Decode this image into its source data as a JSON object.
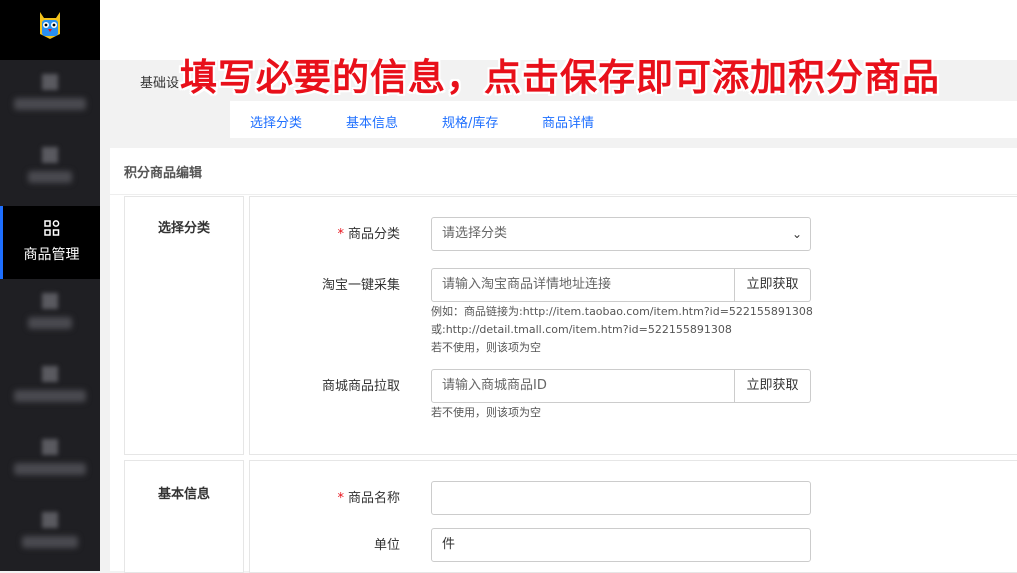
{
  "banner": "填写必要的信息，点击保存即可添加积分商品",
  "breadcrumb": "基础设",
  "sidebar": {
    "active_label": "商品管理",
    "active_icon": "grid-icon"
  },
  "tabs": [
    "选择分类",
    "基本信息",
    "规格/库存",
    "商品详情"
  ],
  "card_title": "积分商品编辑",
  "sections": {
    "category": {
      "title": "选择分类",
      "category_label": "商品分类",
      "category_select": "请选择分类",
      "taobao_label": "淘宝一键采集",
      "taobao_placeholder": "请输入淘宝商品详情地址连接",
      "taobao_button": "立即获取",
      "taobao_hint1": "例如：商品链接为:http://item.taobao.com/item.htm?id=522155891308",
      "taobao_hint2": "或:http://detail.tmall.com/item.htm?id=522155891308",
      "taobao_hint3": "若不使用，则该项为空",
      "mall_label": "商城商品拉取",
      "mall_placeholder": "请输入商城商品ID",
      "mall_button": "立即获取",
      "mall_hint": "若不使用，则该项为空"
    },
    "basic": {
      "title": "基本信息",
      "name_label": "商品名称",
      "name_value": "",
      "unit_label": "单位",
      "unit_value": "件"
    }
  },
  "colors": {
    "accent": "#1e6fff",
    "banner": "#e8101a",
    "sidebar_bg": "#1f1f23"
  }
}
